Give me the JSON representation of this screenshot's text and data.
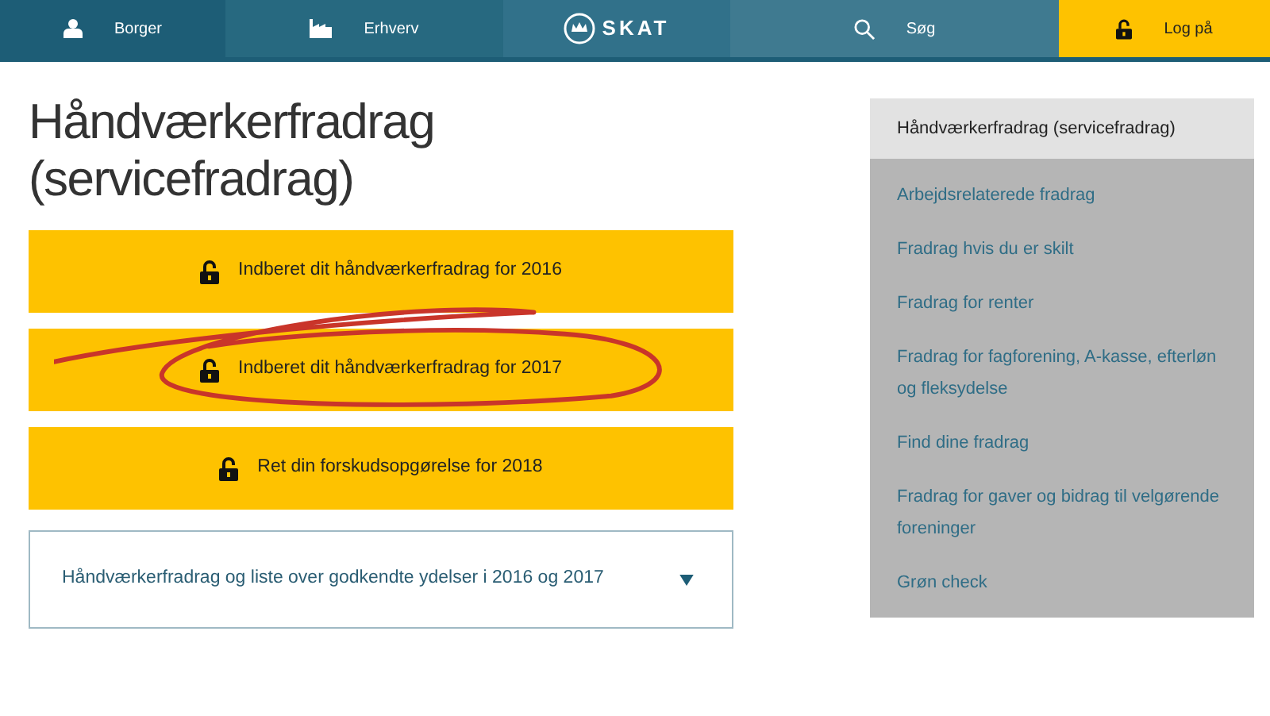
{
  "nav": [
    {
      "kind": "person",
      "label": "Borger",
      "selected": false
    },
    {
      "kind": "factory",
      "label": "Erhverv",
      "selected": false
    },
    {
      "kind": "logo",
      "label": "SKAT",
      "selected": false
    },
    {
      "kind": "search",
      "label": "Søg",
      "selected": false
    },
    {
      "kind": "login",
      "label": "Log på",
      "selected": false
    }
  ],
  "title": "Håndværkerfradrag (servicefradrag)",
  "actions": [
    {
      "label": "Indberet dit håndværkerfradrag for 2016",
      "circled": false
    },
    {
      "label": "Indberet dit håndværkerfradrag for 2017",
      "circled": true
    },
    {
      "label": "Ret din forskudsopgørelse for 2018",
      "circled": false
    }
  ],
  "accordion": {
    "label": "Håndværkerfradrag og liste over godkendte ydelser i 2016 og 2017",
    "expanded": false
  },
  "sidebar": {
    "items": [
      {
        "label": "Håndværkerfradrag (servicefradrag)",
        "selected": true
      },
      {
        "label": "Arbejdsrelaterede fradrag",
        "selected": false
      },
      {
        "label": "Fradrag hvis du er skilt",
        "selected": false
      },
      {
        "label": "Fradrag for renter",
        "selected": false
      },
      {
        "label": "Fradrag for fagforening, A-kasse, efterløn og fleksydelse",
        "selected": false
      },
      {
        "label": "Find dine fradrag",
        "selected": false
      },
      {
        "label": "Fradrag for gaver og bidrag til velgørende foreninger",
        "selected": false
      },
      {
        "label": "Grøn check",
        "selected": false
      }
    ]
  }
}
